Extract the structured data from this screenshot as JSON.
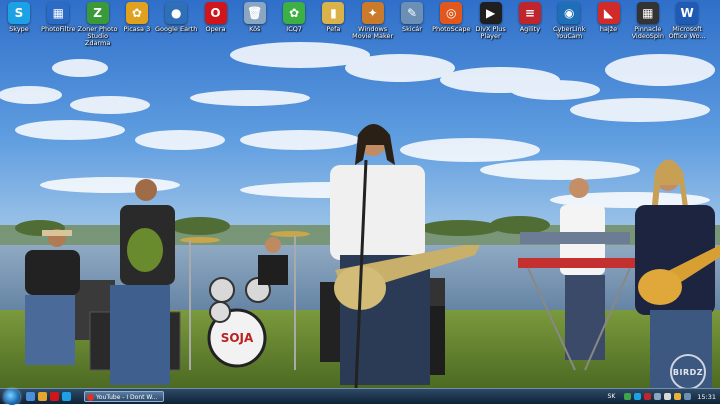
{
  "desktop": {
    "icons": [
      {
        "label": "Skype",
        "icon": "skype-icon",
        "color": "#1da1e6",
        "glyph": "S"
      },
      {
        "label": "PhotoFiltre",
        "icon": "photofiltre-icon",
        "color": "#2b6bc5",
        "glyph": "▦"
      },
      {
        "label": "Zoner Photo Studio Zdarma",
        "icon": "zoner-icon",
        "color": "#3a9a3a",
        "glyph": "Z"
      },
      {
        "label": "Picasa 3",
        "icon": "picasa-icon",
        "color": "#e0a020",
        "glyph": "✿"
      },
      {
        "label": "Google Earth",
        "icon": "google-earth-icon",
        "color": "#2f6fb8",
        "glyph": "●"
      },
      {
        "label": "Opera",
        "icon": "opera-icon",
        "color": "#d0161b",
        "glyph": "O"
      },
      {
        "label": "Kôš",
        "icon": "recycle-bin-icon",
        "color": "#8aa6c0",
        "glyph": "🗑"
      },
      {
        "label": "ICQ7",
        "icon": "icq-icon",
        "color": "#3cb043",
        "glyph": "✿"
      },
      {
        "label": "Pefa",
        "icon": "pefa-icon",
        "color": "#d9b24a",
        "glyph": "▮"
      },
      {
        "label": "Windows Movie Maker",
        "icon": "movie-maker-icon",
        "color": "#c97a2b",
        "glyph": "✦"
      },
      {
        "label": "Skicár",
        "icon": "paint-icon",
        "color": "#6c8fb5",
        "glyph": "✎"
      },
      {
        "label": "PhotoScape",
        "icon": "photoscape-icon",
        "color": "#e2571c",
        "glyph": "◎"
      },
      {
        "label": "DivX Plus Player",
        "icon": "divx-icon",
        "color": "#1f1f1f",
        "glyph": "▶"
      },
      {
        "label": "Agility",
        "icon": "agility-icon",
        "color": "#c0242d",
        "glyph": "≡"
      },
      {
        "label": "CyberLink YouCam",
        "icon": "youcam-icon",
        "color": "#1e6fb8",
        "glyph": "◉"
      },
      {
        "label": "hajže",
        "icon": "hajze-icon",
        "color": "#d02a2a",
        "glyph": "◣"
      },
      {
        "label": "Pinnacle VideoSpin",
        "icon": "videospin-icon",
        "color": "#333333",
        "glyph": "▦"
      },
      {
        "label": "Microsoft Office Wo...",
        "icon": "word-icon",
        "color": "#1f5bb5",
        "glyph": "W"
      }
    ]
  },
  "wallpaper": {
    "bass_drum_text": "SOJA",
    "watermark": "BIRDZ"
  },
  "taskbar": {
    "task_label": "YouTube - I Dont W...",
    "language": "SK",
    "clock": "15:31"
  }
}
